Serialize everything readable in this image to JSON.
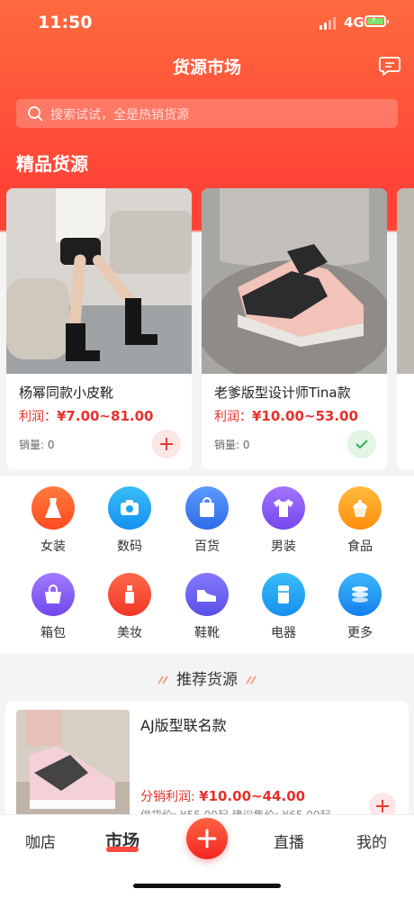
{
  "status_bar": {
    "time": "11:50",
    "network": "4G"
  },
  "header": {
    "title": "货源市场",
    "search_placeholder": "搜索试试，全是热销货源"
  },
  "featured": {
    "title": "精品货源",
    "items": [
      {
        "name": "杨幂同款小皮靴",
        "profit_label": "利润：",
        "profit_range": "¥7.00~81.00",
        "sales": "销量: 0",
        "status": "add"
      },
      {
        "name": "老爹版型设计师Tina款",
        "profit_label": "利润：",
        "profit_range": "¥10.00~53.00",
        "sales": "销量: 0",
        "status": "added"
      }
    ]
  },
  "categories": [
    {
      "label": "女装",
      "icon": "dress-icon",
      "color": "#ff5a2b"
    },
    {
      "label": "数码",
      "icon": "camera-icon",
      "color": "#1ea4f5"
    },
    {
      "label": "百货",
      "icon": "shopping-bag-icon",
      "color": "#3f7cf2"
    },
    {
      "label": "男装",
      "icon": "tshirt-icon",
      "color": "#8b5cf0"
    },
    {
      "label": "食品",
      "icon": "cupcake-icon",
      "color": "#ffa11c"
    },
    {
      "label": "箱包",
      "icon": "handbag-icon",
      "color": "#8a5cf2"
    },
    {
      "label": "美妆",
      "icon": "lipstick-icon",
      "color": "#ff4b3a"
    },
    {
      "label": "鞋靴",
      "icon": "shoe-icon",
      "color": "#6a61ee"
    },
    {
      "label": "电器",
      "icon": "fridge-icon",
      "color": "#1ea4f5"
    },
    {
      "label": "更多",
      "icon": "stack-icon",
      "color": "#1e9bf3"
    }
  ],
  "recommend": {
    "title": "推荐货源",
    "item": {
      "name": "AJ版型联名款",
      "profit_label": "分销利润: ",
      "profit_range": "¥10.00~44.00",
      "price_line": "供货价: ¥55.00起  建议售价: ¥65.00起"
    }
  },
  "tabs": [
    {
      "label": "咖店",
      "active": false
    },
    {
      "label": "市场",
      "active": true
    },
    {
      "label": "直播",
      "active": false
    },
    {
      "label": "我的",
      "active": false
    }
  ],
  "colors": {
    "brand": "#ff4437",
    "profit": "#e8302a",
    "success": "#2fb55a"
  }
}
